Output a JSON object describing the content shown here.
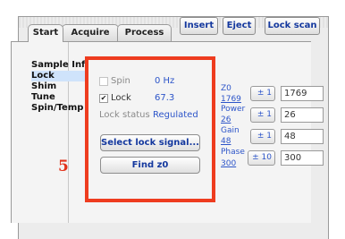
{
  "tabs": [
    {
      "label": "Start"
    },
    {
      "label": "Acquire"
    },
    {
      "label": "Process"
    }
  ],
  "toolbar": {
    "insert_label": "Insert",
    "eject_label": "Eject",
    "lock_scan_label": "Lock scan"
  },
  "sidebar": {
    "items": [
      {
        "label": "Sample Info"
      },
      {
        "label": "Lock"
      },
      {
        "label": "Shim"
      },
      {
        "label": "Tune"
      },
      {
        "label": "Spin/Temp"
      }
    ]
  },
  "lock_panel": {
    "spin_label": "Spin",
    "spin_value": "0 Hz",
    "spin_checked": false,
    "lock_label": "Lock",
    "lock_value": "67.3",
    "lock_checked": true,
    "checkmark": "✔",
    "lock_status_label": "Lock status",
    "lock_status_value": "Regulated",
    "select_lock_signal_label": "Select lock signal...",
    "find_z0_label": "Find z0"
  },
  "params": [
    {
      "label": "Z0",
      "value": "1769",
      "step": "± 1",
      "field": "1769"
    },
    {
      "label": "Power",
      "value": "26",
      "step": "± 1",
      "field": "26"
    },
    {
      "label": "Gain",
      "value": "48",
      "step": "± 1",
      "field": "48"
    },
    {
      "label": "Phase",
      "value": "300",
      "step": "± 10",
      "field": "300"
    }
  ],
  "annotation": {
    "step_number": "5",
    "highlight_color": "#ee3c1f"
  },
  "colors": {
    "link_blue": "#2d55c9",
    "button_text": "#14389e",
    "selection": "#cfe3fb"
  }
}
